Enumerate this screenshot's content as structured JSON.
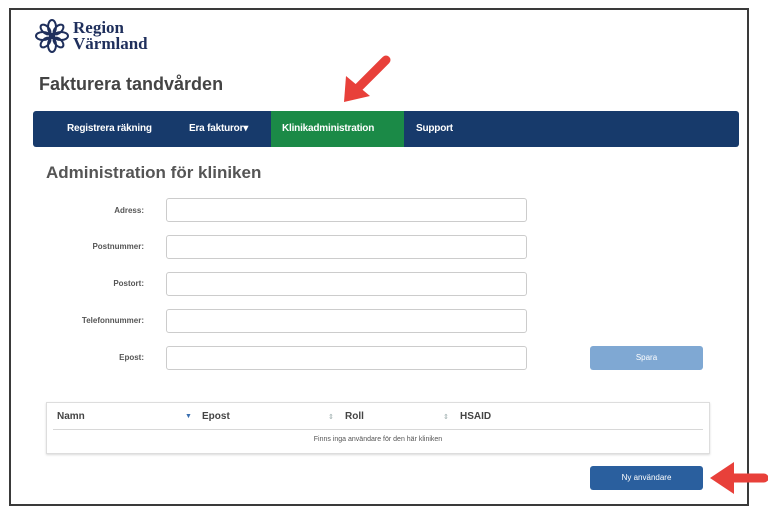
{
  "logo": {
    "line1": "Region",
    "line2": "Värmland",
    "icon": "flower-logo-icon"
  },
  "app_title": "Fakturera tandvården",
  "nav": {
    "items": [
      {
        "label": "Registrera räkning",
        "active": false
      },
      {
        "label": "Era fakturor",
        "active": false,
        "dropdown_caret": "▾"
      },
      {
        "label": "Klinikadministration",
        "active": true
      },
      {
        "label": "Support",
        "active": false
      }
    ]
  },
  "section_title": "Administration för kliniken",
  "form": {
    "address_label": "Adress:",
    "postal_code_label": "Postnummer:",
    "city_label": "Postort:",
    "phone_label": "Telefonnummer:",
    "email_label": "Epost:",
    "address_value": "",
    "postal_code_value": "",
    "city_value": "",
    "phone_value": "",
    "email_value": "",
    "save_label": "Spara"
  },
  "table": {
    "columns": [
      "Namn",
      "Epost",
      "Roll",
      "HSAID"
    ],
    "empty_message": "Finns inga användare för den här kliniken"
  },
  "new_user_label": "Ny användare",
  "colors": {
    "navbar": "#173a6b",
    "nav_active": "#1b8a47",
    "save_button": "#7fa8d3",
    "new_user_button": "#2a5f9e",
    "annotation_arrow": "#e8403a"
  }
}
